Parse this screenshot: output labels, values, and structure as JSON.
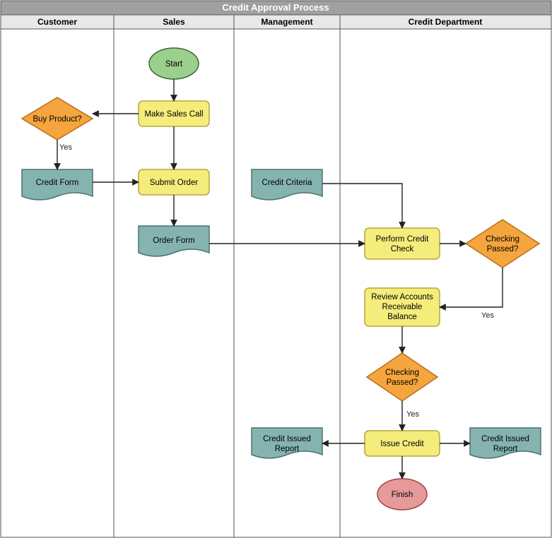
{
  "title": "Credit Approval Process",
  "lanes": {
    "customer": "Customer",
    "sales": "Sales",
    "management": "Management",
    "credit": "Credit Department"
  },
  "nodes": {
    "start": "Start",
    "makeSales": "Make Sales Call",
    "buyProduct": "Buy Product?",
    "creditForm": "Credit Form",
    "submitOrder": "Submit Order",
    "orderForm": "Order Form",
    "creditCriteria": "Credit Criteria",
    "performCheck1": "Perform Credit",
    "performCheck2": "Check",
    "checkPassed1a": "Checking",
    "checkPassed1b": "Passed?",
    "review1": "Review Accounts",
    "review2": "Receivable",
    "review3": "Balance",
    "checkPassed2a": "Checking",
    "checkPassed2b": "Passed?",
    "issueCredit": "Issue Credit",
    "reportL1": "Credit Issued",
    "reportL2": "Report",
    "reportR1": "Credit Issued",
    "reportR2": "Report",
    "finish": "Finish"
  },
  "edges": {
    "yes": "Yes"
  }
}
